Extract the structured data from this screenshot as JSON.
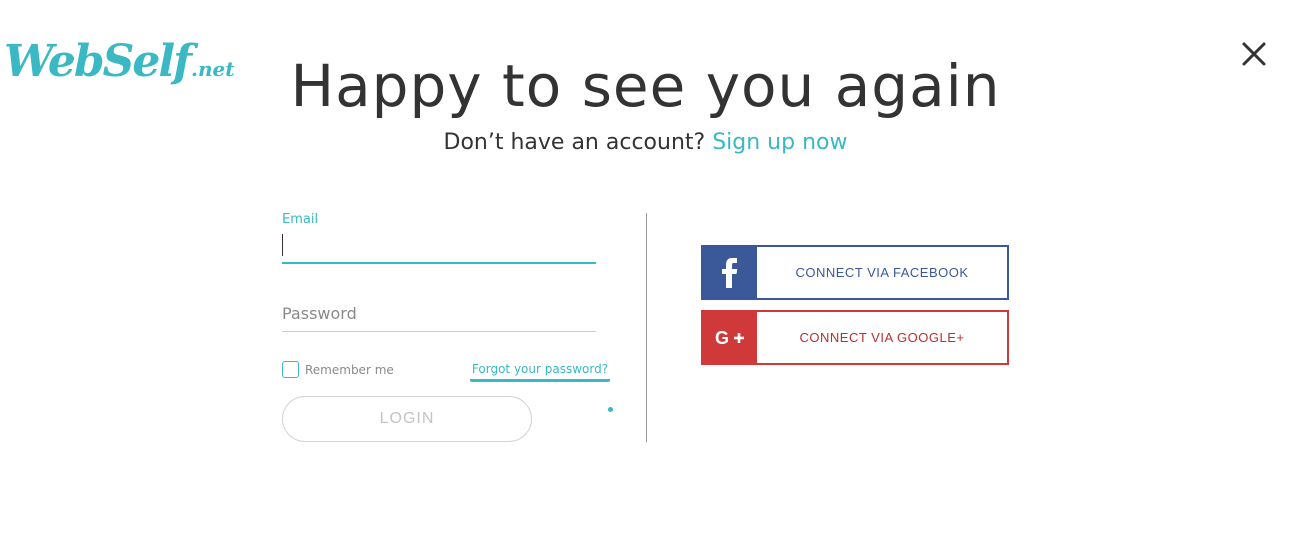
{
  "logo": {
    "name": "WebSelf",
    "tld": ".net"
  },
  "header": {
    "title": "Happy to see you again",
    "subtitle_prefix": "Don’t have an account?",
    "signup_link": "Sign up now"
  },
  "form": {
    "email_label": "Email",
    "email_value": "",
    "password_placeholder": "Password",
    "remember_label": "Remember me",
    "remember_checked": false,
    "forgot_link": "Forgot your password?",
    "login_label": "LOGIN"
  },
  "social": {
    "facebook_label": "CONNECT VIA FACEBOOK",
    "facebook_icon": "facebook-icon",
    "google_label": "CONNECT VIA GOOGLE+",
    "google_icon": "google-plus-icon"
  },
  "colors": {
    "accent": "#3ab8c3",
    "facebook": "#3b5998",
    "google": "#d0393a",
    "text": "#333333"
  }
}
